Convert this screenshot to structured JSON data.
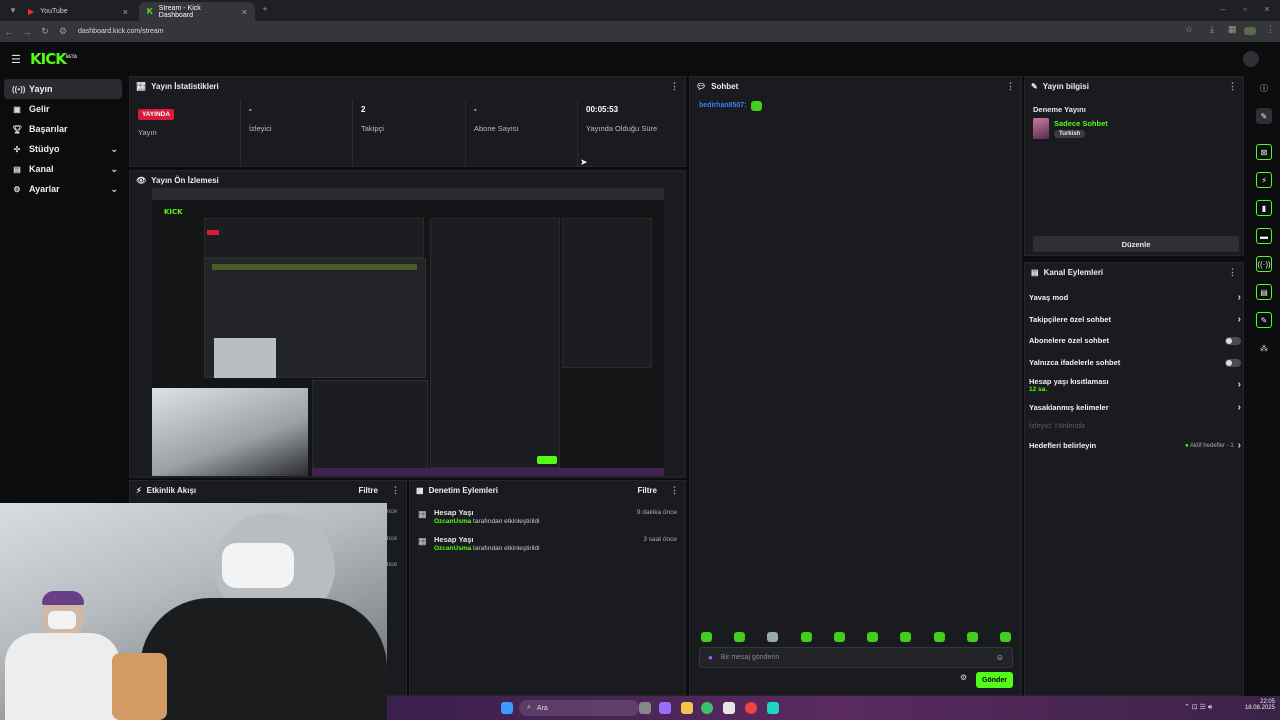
{
  "browser": {
    "tabs": [
      {
        "label": "YouTube",
        "active": false
      },
      {
        "label": "Stream - Kick Dashboard",
        "active": true
      }
    ],
    "url": "dashboard.kick.com/stream"
  },
  "logo": {
    "text": "KICK",
    "sup": "BETA"
  },
  "sidebar": {
    "items": [
      {
        "label": "Yayın",
        "icon": "broadcast-icon"
      },
      {
        "label": "Gelir",
        "icon": "revenue-icon"
      },
      {
        "label": "Başarılar",
        "icon": "trophy-icon"
      },
      {
        "label": "Stüdyo",
        "icon": "studio-icon"
      },
      {
        "label": "Kanal",
        "icon": "channel-icon"
      },
      {
        "label": "Ayarlar",
        "icon": "gear-icon"
      }
    ]
  },
  "stats": {
    "title": "Yayın İstatistikleri",
    "items": [
      {
        "value": "YAYINDA",
        "label": "Yayın"
      },
      {
        "value": "-",
        "label": "İzleyici"
      },
      {
        "value": "2",
        "label": "Takipçi"
      },
      {
        "value": "-",
        "label": "Abone Sayısı"
      },
      {
        "value": "00:05:53",
        "label": "Yayında Olduğu Süre"
      }
    ]
  },
  "preview": {
    "title": "Yayın Ön İzlemesi"
  },
  "activity": {
    "title": "Etkinlik Akışı",
    "filter": "Filtre",
    "times": [
      "önce",
      "önce",
      "önce"
    ]
  },
  "moderation": {
    "title": "Denetim Eylemleri",
    "filter": "Filtre",
    "items": [
      {
        "title": "Hesap Yaşı",
        "user": "OzcanUsma",
        "action": "tarafından etkinleştirildi",
        "time": "9 dakika önce"
      },
      {
        "title": "Hesap Yaşı",
        "user": "OzcanUsma",
        "action": "tarafından etkinleştirildi",
        "time": "3 saat önce"
      }
    ]
  },
  "chat": {
    "title": "Sohbet",
    "user": "bedirhan8507:",
    "placeholder": "Bir mesaj gönderin",
    "send": "Gönder"
  },
  "streamInfo": {
    "title": "Yayın bilgisi",
    "name": "Deneme Yayını",
    "category": "Sadece Sohbet",
    "tag": "Turkish",
    "edit": "Düzenle"
  },
  "channelActions": {
    "title": "Kanal Eylemleri",
    "rows": [
      {
        "label": "Yavaş mod",
        "kind": "arrow"
      },
      {
        "label": "Takipçilere özel sohbet",
        "kind": "arrow"
      },
      {
        "label": "Abonelere özel sohbet",
        "kind": "toggle"
      },
      {
        "label": "Yalnızca ifadelerle sohbet",
        "kind": "toggle"
      },
      {
        "label": "Hesap yaşı kısıtlaması",
        "sub": "12 sa.",
        "kind": "arrow"
      },
      {
        "label": "Yasaklanmış kelimeler",
        "kind": "arrow"
      },
      {
        "label": "İzleyici Yönlendir",
        "kind": "disabled"
      },
      {
        "label": "Hedefleri belirleyin",
        "extra": "Aktif hedefler - 1",
        "kind": "arrow"
      }
    ]
  },
  "taskbar": {
    "search": "Ara",
    "time": "22:05",
    "date": "18.08.2025"
  },
  "colors": {
    "accent": "#53fc18",
    "live": "#d7193a",
    "panel": "#191b1e"
  }
}
